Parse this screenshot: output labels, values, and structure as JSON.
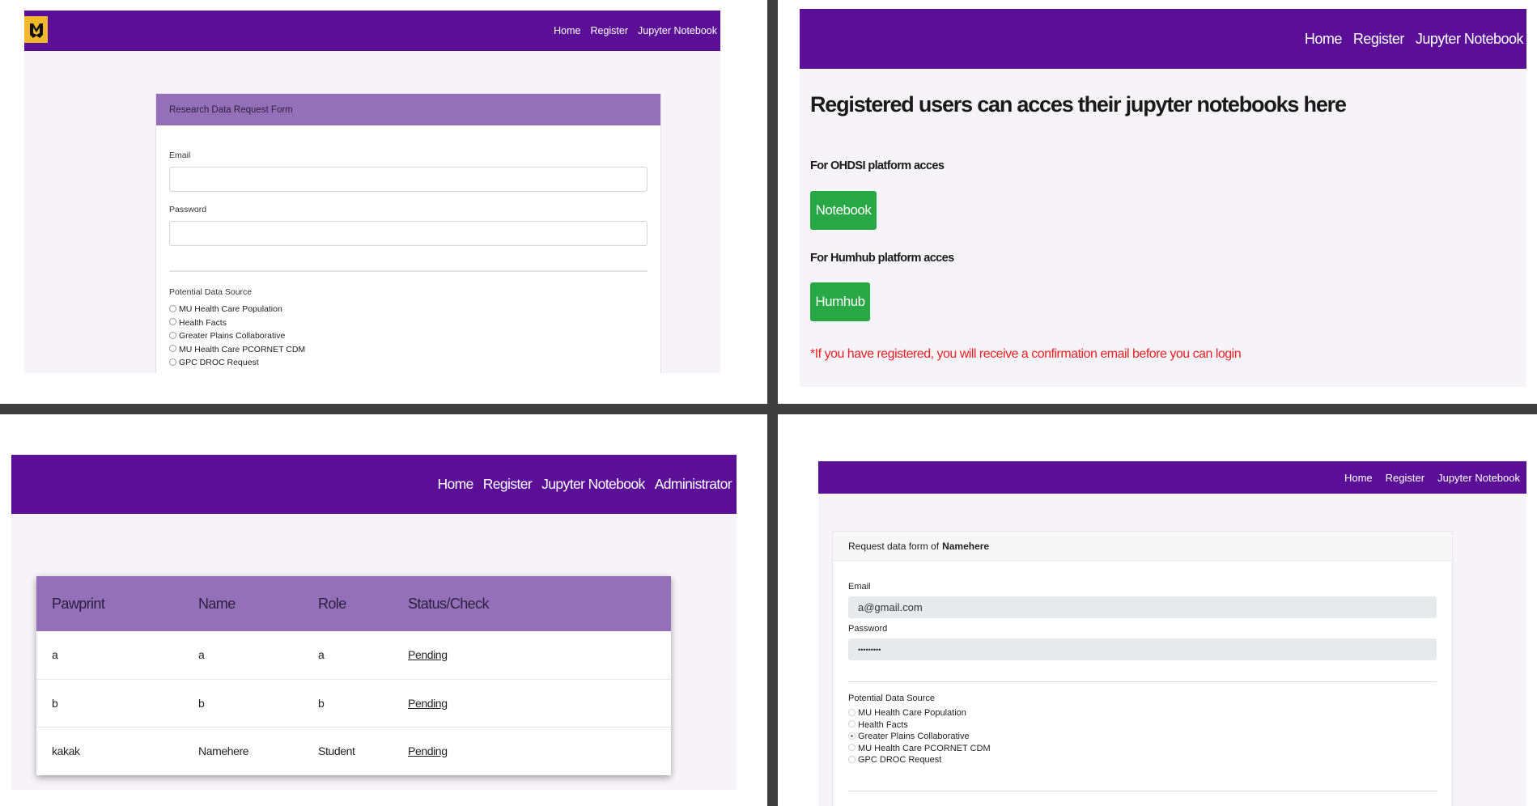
{
  "colors": {
    "navbar": "#5a0f96",
    "card_header": "#9370b7",
    "green_button": "#28a745",
    "notice": "#ee2222"
  },
  "panel_tl": {
    "logo_icon": "mu-tiger-logo",
    "nav": [
      "Home",
      "Register",
      "Jupyter Notebook"
    ],
    "form_title": "Research Data Request Form",
    "email_label": "Email",
    "password_label": "Password",
    "source_label": "Potential Data Source",
    "sources": [
      "MU Health Care Population",
      "Health Facts",
      "Greater Plains Collaborative",
      "MU Health Care PCORNET CDM",
      "GPC DROC Request"
    ]
  },
  "panel_tr": {
    "nav": [
      "Home",
      "Register",
      "Jupyter Notebook"
    ],
    "heading": "Registered users can acces their jupyter notebooks here",
    "ohdsi_label": "For OHDSI platform acces",
    "notebook_button": "Notebook",
    "humhub_label": "For Humhub platform acces",
    "humhub_button": "Humhub",
    "notice": "*If you have registered, you will receive a confirmation email before you can login"
  },
  "panel_bl": {
    "nav": [
      "Home",
      "Register",
      "Jupyter Notebook",
      "Administrator"
    ],
    "columns": [
      "Pawprint",
      "Name",
      "Role",
      "Status/Check"
    ],
    "rows": [
      [
        "a",
        "a",
        "a",
        "Pending"
      ],
      [
        "b",
        "b",
        "b",
        "Pending"
      ],
      [
        "kakak",
        "Namehere",
        "Student",
        "Pending"
      ]
    ]
  },
  "panel_br": {
    "nav": [
      "Home",
      "Register",
      "Jupyter Notebook"
    ],
    "form_title_prefix": "Request data form of",
    "form_title_name": "Namehere",
    "email_label": "Email",
    "email_value": "a@gmail.com",
    "password_label": "Password",
    "password_value": "•••••••••",
    "source_label": "Potential Data Source",
    "sources": [
      "MU Health Care Population",
      "Health Facts",
      "Greater Plains Collaborative",
      "MU Health Care PCORNET CDM",
      "GPC DROC Request"
    ],
    "selected_source": "Greater Plains Collaborative"
  }
}
